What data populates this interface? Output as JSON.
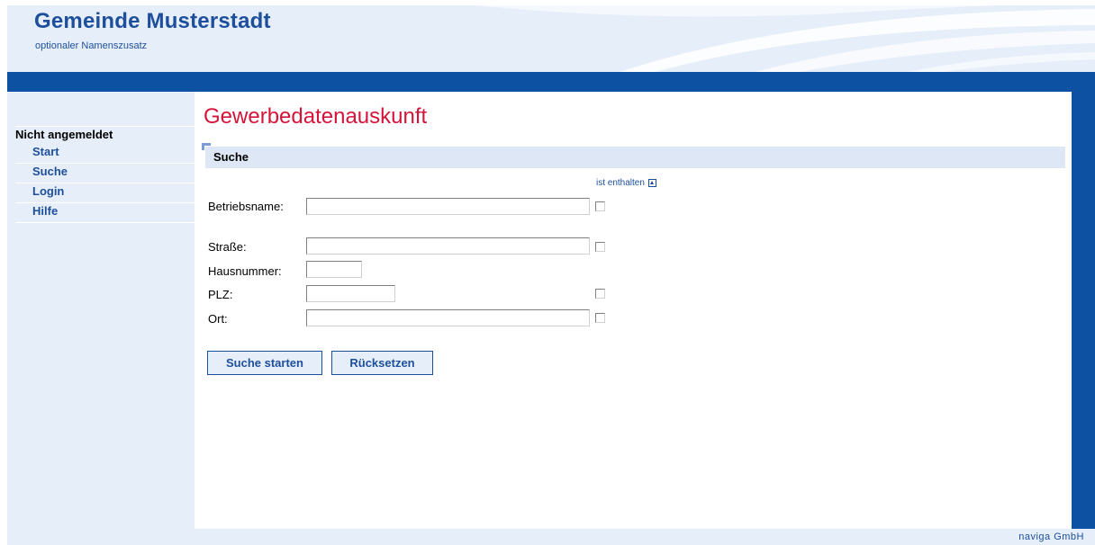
{
  "site": {
    "title": "Gemeinde Musterstadt",
    "subtitle": "optionaler Namenszusatz"
  },
  "sidebar": {
    "status": "Nicht angemeldet",
    "items": [
      {
        "label": "Start"
      },
      {
        "label": "Suche"
      },
      {
        "label": "Login"
      },
      {
        "label": "Hilfe"
      }
    ]
  },
  "main": {
    "title": "Gewerbedatenauskunft",
    "section_title": "Suche",
    "contains_hint": "ist enthalten",
    "fields": {
      "betriebsname": {
        "label": "Betriebsname:",
        "value": ""
      },
      "strasse": {
        "label": "Straße:",
        "value": ""
      },
      "hausnummer": {
        "label": "Hausnummer:",
        "value": ""
      },
      "plz": {
        "label": "PLZ:",
        "value": ""
      },
      "ort": {
        "label": "Ort:",
        "value": ""
      }
    },
    "buttons": {
      "search": "Suche starten",
      "reset": "Rücksetzen"
    }
  },
  "footer": {
    "text": "naviga GmbH"
  },
  "colors": {
    "brand_blue": "#0d51a2",
    "title_red": "#d4143a",
    "light_blue": "#e6eef9"
  }
}
